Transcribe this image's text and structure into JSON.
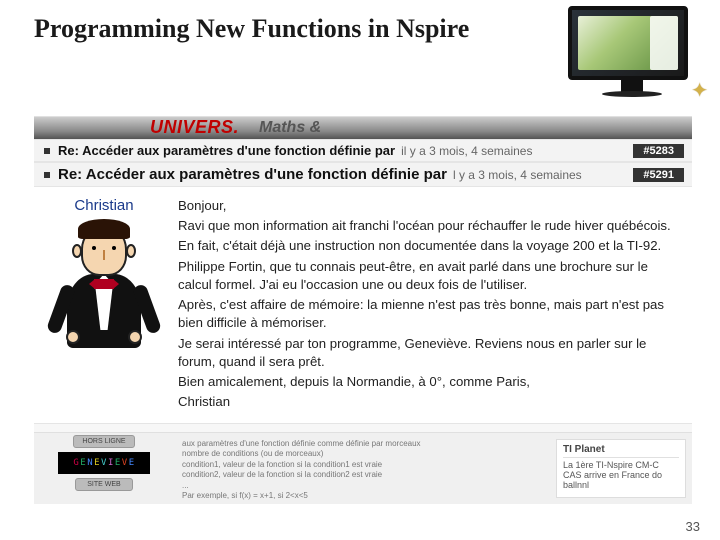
{
  "slide": {
    "title": "Programming New Functions in Nspire",
    "page_number": "33"
  },
  "header_bg": {
    "univers": "UNIVERS.",
    "maths": "Maths  &"
  },
  "threads": [
    {
      "title": "Re: Accéder aux paramètres d'une fonction définie par",
      "time": "il y a 3 mois, 4 semaines",
      "id": "#5283"
    },
    {
      "title": "Re: Accéder aux paramètres d'une fonction définie par",
      "time": "l y a 3 mois, 4 semaines",
      "id": "#5291"
    }
  ],
  "post": {
    "username": "Christian",
    "lines": [
      "Bonjour,",
      "Ravi que mon information ait franchi l'océan pour réchauffer le rude hiver québécois.",
      "En fait, c'était déjà une instruction non documentée dans la voyage 200 et la TI-92.",
      "Philippe Fortin, que tu connais peut-être, en avait parlé dans une brochure sur le calcul formel. J'ai eu l'occasion une ou deux fois de l'utiliser.",
      "Après, c'est affaire de mémoire: la mienne n'est pas très bonne, mais part n'est pas bien difficile à mémoriser.",
      "Je serai intéressé par ton programme, Geneviève. Reviens nous en parler sur le forum, quand il sera prêt.",
      "Bien amicalement, depuis la Normandie, à 0°, comme Paris,",
      "Christian"
    ]
  },
  "below": {
    "pill1": "HORS LIGNE",
    "pill2": "SITE WEB",
    "genevieve": [
      "G",
      "E",
      "N",
      "E",
      "V",
      "I",
      "E",
      "V",
      "E"
    ],
    "snippet_lines": [
      "aux paramètres d'une fonction définie comme définie par morceaux",
      "nombre de conditions (ou de morceaux)",
      "condition1, valeur de la fonction si la condition1 est vraie",
      "condition2, valeur de la fonction si la condition2 est vraie",
      "...",
      "Par exemple, si f(x) = x+1, si 2<x<5"
    ],
    "tiplanet": {
      "header": "TI Planet",
      "text": "La 1ère TI-Nspire CM-C CAS arrive en France do ballnnl"
    }
  }
}
